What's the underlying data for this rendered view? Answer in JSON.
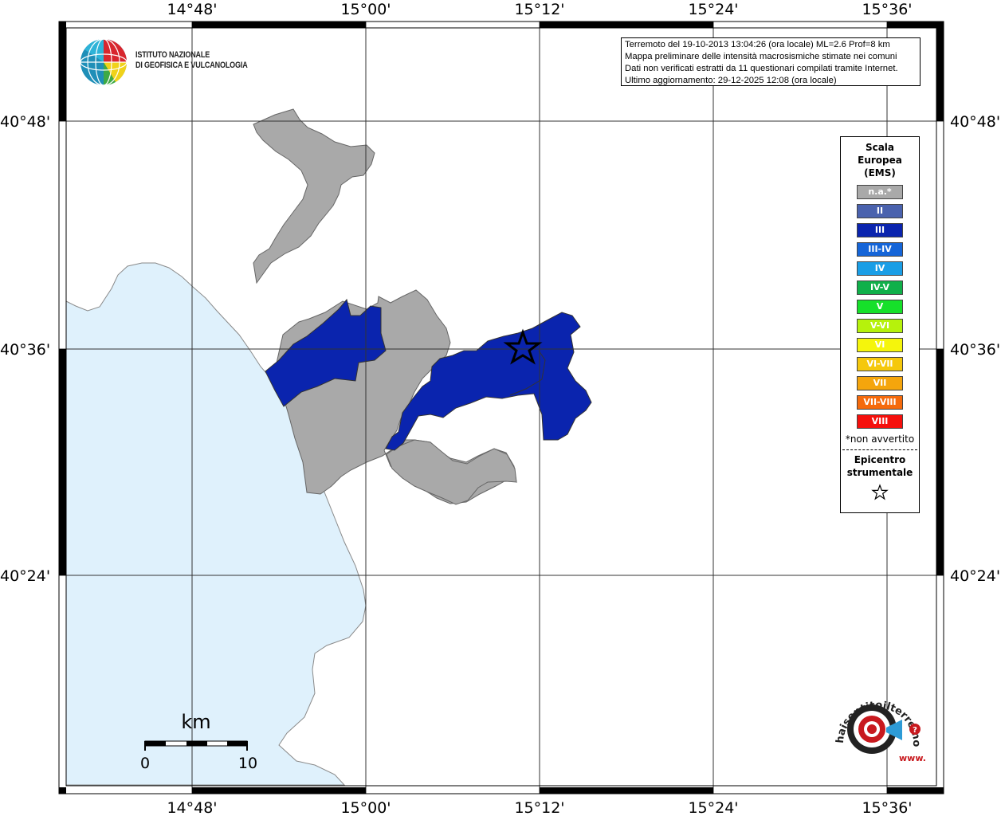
{
  "map": {
    "longitude_labels": [
      "14°48'",
      "15°00'",
      "15°12'",
      "15°24'",
      "15°36'"
    ],
    "latitude_labels": [
      "40°48'",
      "40°36'",
      "40°24'"
    ],
    "colors": {
      "sea": "#dff1fc",
      "land": "#ffffff",
      "not_felt": "#a9a9a9",
      "intensity_III": "#0a24ae",
      "boundary": "#555555"
    },
    "epicenter": {
      "label": "epicenter-star"
    }
  },
  "info": {
    "line1": "Terremoto del 19-10-2013 13:04:26 (ora locale) ML=2.6 Prof=8 km",
    "line2": "Mappa preliminare delle intensità macrosismiche stimate nei comuni",
    "line3": "Dati non verificati estratti da 11 questionari compilati tramite Internet.",
    "line4": "Ultimo aggiornamento: 29-12-2025 12:08 (ora locale)"
  },
  "legend": {
    "title_line1": "Scala",
    "title_line2": "Europea",
    "title_line3": "(EMS)",
    "items": [
      {
        "label": "n.a.*",
        "color": "#a9a9a9"
      },
      {
        "label": "II",
        "color": "#4a62ae"
      },
      {
        "label": "III",
        "color": "#0a24ae"
      },
      {
        "label": "III-IV",
        "color": "#1565d8"
      },
      {
        "label": "IV",
        "color": "#1a9ee6"
      },
      {
        "label": "IV-V",
        "color": "#10b04a"
      },
      {
        "label": "V",
        "color": "#16e02a"
      },
      {
        "label": "V-VI",
        "color": "#b6f20c"
      },
      {
        "label": "VI",
        "color": "#f5f50c"
      },
      {
        "label": "VI-VII",
        "color": "#f5c80c"
      },
      {
        "label": "VII",
        "color": "#f5a50c"
      },
      {
        "label": "VII-VIII",
        "color": "#f56a0c"
      },
      {
        "label": "VIII",
        "color": "#f5100c"
      }
    ],
    "note": "*non avvertito",
    "epicenter_line1": "Epicentro",
    "epicenter_line2": "strumentale"
  },
  "scale_bar": {
    "unit": "km",
    "start": "0",
    "end": "10"
  },
  "logos": {
    "ingv_line1": "ISTITUTO NAZIONALE",
    "ingv_line2": "DI GEOFISICA E VULCANOLOGIA",
    "hsi_text": "haisentitoilterremoto.it",
    "hsi_www": "www."
  }
}
